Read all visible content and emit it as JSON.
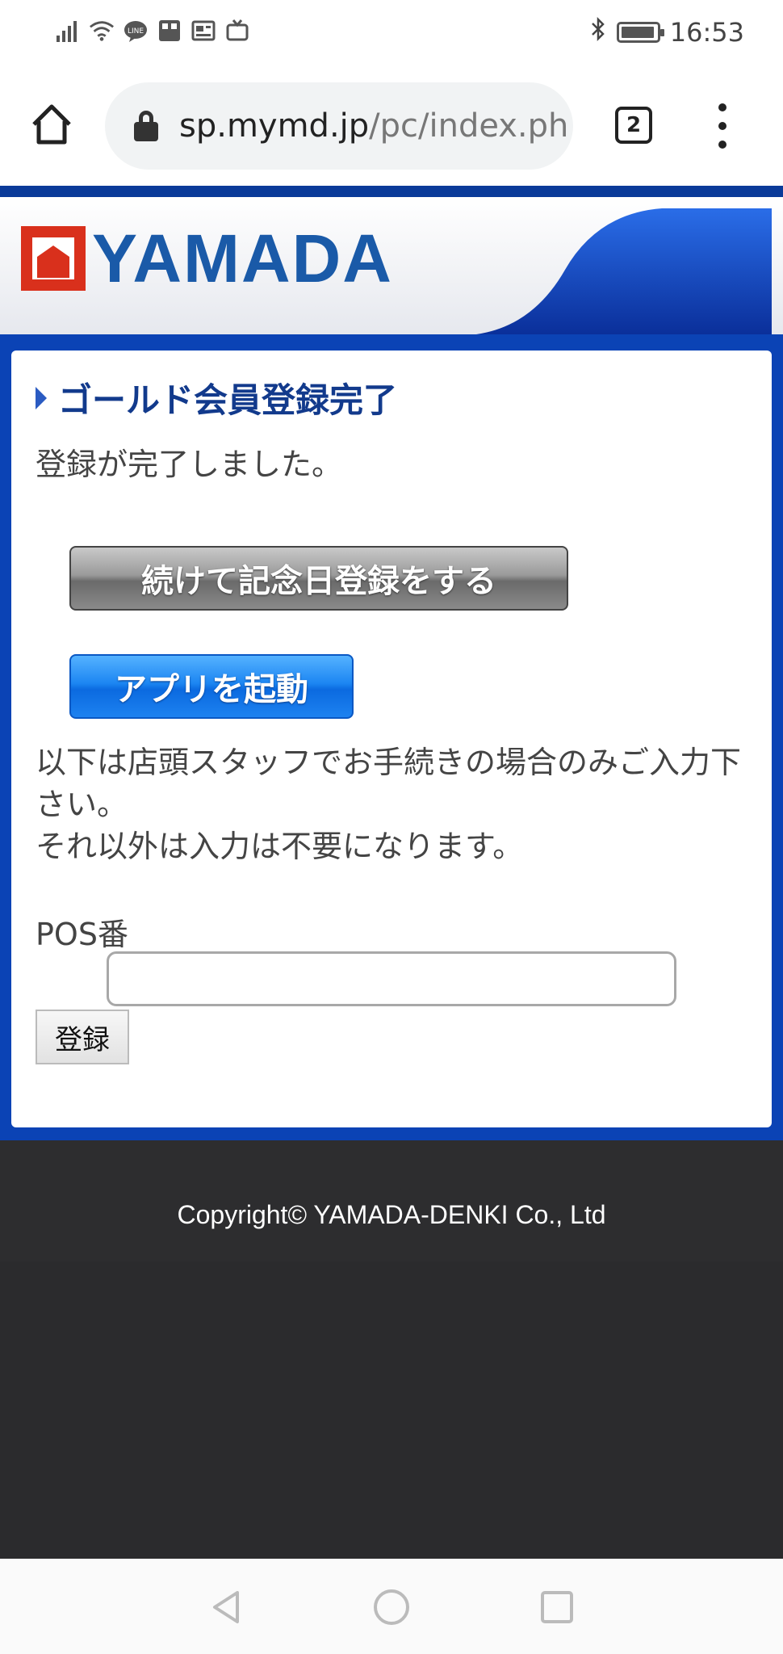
{
  "status_bar": {
    "time": "16:53",
    "left_icons": [
      "signal-icon",
      "wifi-icon",
      "line-app-icon",
      "rakuma-app-icon",
      "news-app-icon",
      "tv-app-icon"
    ],
    "right_icons": [
      "bluetooth-icon",
      "battery-icon"
    ]
  },
  "browser": {
    "url_host": "sp.mymd.jp",
    "url_path": "/pc/index.ph",
    "tab_count": "2"
  },
  "header": {
    "logo_text": "YAMADA"
  },
  "main": {
    "title": "ゴールド会員登録完了",
    "message": "登録が完了しました。",
    "continue_button": "続けて記念日登録をする",
    "app_button": "アプリを起動",
    "note_line1": "以下は店頭スタッフでお手続きの場合のみご入力下さい。",
    "note_line2": "それ以外は入力は不要になります。",
    "pos_label": "POS番",
    "pos_value": "",
    "register_button": "登録"
  },
  "footer": {
    "copyright": "Copyright© YAMADA-DENKI Co., Ltd"
  },
  "colors": {
    "brand_blue": "#0b43b5",
    "title_blue": "#123a8c",
    "logo_red": "#d9301c",
    "app_button_blue": "#1c86f2",
    "footer_dark": "#2b2b2d"
  }
}
